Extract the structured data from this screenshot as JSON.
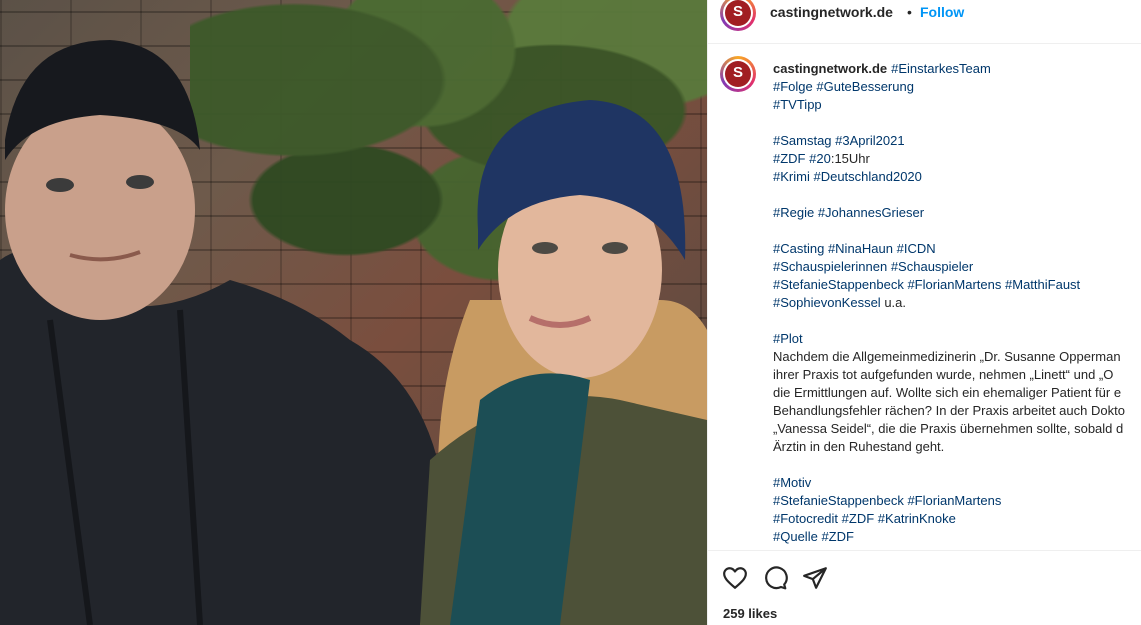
{
  "post": {
    "username": "castingnetwork.de",
    "avatar_text": "S",
    "dot": "•",
    "follow_label": "Follow",
    "caption_lines": [
      [
        {
          "t": "#EinstarkesTeam",
          "tag": true
        }
      ],
      [
        {
          "t": "#Folge",
          "tag": true
        },
        {
          "t": " "
        },
        {
          "t": "#GuteBesserung",
          "tag": true
        }
      ],
      [
        {
          "t": "#TVTipp",
          "tag": true
        }
      ],
      [],
      [
        {
          "t": "#Samstag",
          "tag": true
        },
        {
          "t": " "
        },
        {
          "t": "#3April2021",
          "tag": true
        }
      ],
      [
        {
          "t": "#ZDF",
          "tag": true
        },
        {
          "t": " "
        },
        {
          "t": "#20",
          "tag": true
        },
        {
          "t": ":15Uhr"
        }
      ],
      [
        {
          "t": "#Krimi",
          "tag": true
        },
        {
          "t": " "
        },
        {
          "t": "#Deutschland2020",
          "tag": true
        }
      ],
      [],
      [
        {
          "t": "#Regie",
          "tag": true
        },
        {
          "t": " "
        },
        {
          "t": "#JohannesGrieser",
          "tag": true
        }
      ],
      [],
      [
        {
          "t": "#Casting",
          "tag": true
        },
        {
          "t": " "
        },
        {
          "t": "#NinaHaun",
          "tag": true
        },
        {
          "t": " "
        },
        {
          "t": "#ICDN",
          "tag": true
        }
      ],
      [
        {
          "t": "#Schauspielerinnen",
          "tag": true
        },
        {
          "t": " "
        },
        {
          "t": "#Schauspieler",
          "tag": true
        }
      ],
      [
        {
          "t": "#StefanieStappenbeck",
          "tag": true
        },
        {
          "t": " "
        },
        {
          "t": "#FlorianMartens",
          "tag": true
        },
        {
          "t": " "
        },
        {
          "t": "#MatthiFaust",
          "tag": true
        }
      ],
      [
        {
          "t": "#SophievonKessel",
          "tag": true
        },
        {
          "t": " u.a."
        }
      ],
      [],
      [
        {
          "t": "#Plot",
          "tag": true
        }
      ],
      [
        {
          "t": "Nachdem die Allgemeinmedizinerin „Dr. Susanne Opperman"
        }
      ],
      [
        {
          "t": "ihrer Praxis tot aufgefunden wurde, nehmen „Linett“ und „O"
        }
      ],
      [
        {
          "t": "die Ermittlungen auf. Wollte sich ein ehemaliger Patient für e"
        }
      ],
      [
        {
          "t": "Behandlungsfehler rächen? In der Praxis arbeitet auch Dokto"
        }
      ],
      [
        {
          "t": "„Vanessa Seidel“, die die Praxis übernehmen sollte, sobald d"
        }
      ],
      [
        {
          "t": "Ärztin in den Ruhestand geht."
        }
      ],
      [],
      [
        {
          "t": "#Motiv",
          "tag": true
        }
      ],
      [
        {
          "t": "#StefanieStappenbeck",
          "tag": true
        },
        {
          "t": " "
        },
        {
          "t": "#FlorianMartens",
          "tag": true
        }
      ],
      [
        {
          "t": "#Fotocredit",
          "tag": true
        },
        {
          "t": " "
        },
        {
          "t": "#ZDF",
          "tag": true
        },
        {
          "t": " "
        },
        {
          "t": "#KatrinKnoke",
          "tag": true
        }
      ],
      [
        {
          "t": "#Quelle",
          "tag": true
        },
        {
          "t": " "
        },
        {
          "t": "#ZDF",
          "tag": true
        }
      ]
    ],
    "likes": "259 likes"
  },
  "icons": {
    "like": "heart-icon",
    "comment": "comment-icon",
    "share": "paper-plane-icon"
  },
  "colors": {
    "accent": "#0095f6",
    "hashtag": "#00376b",
    "text": "#262626",
    "logo": "#a11e22"
  }
}
